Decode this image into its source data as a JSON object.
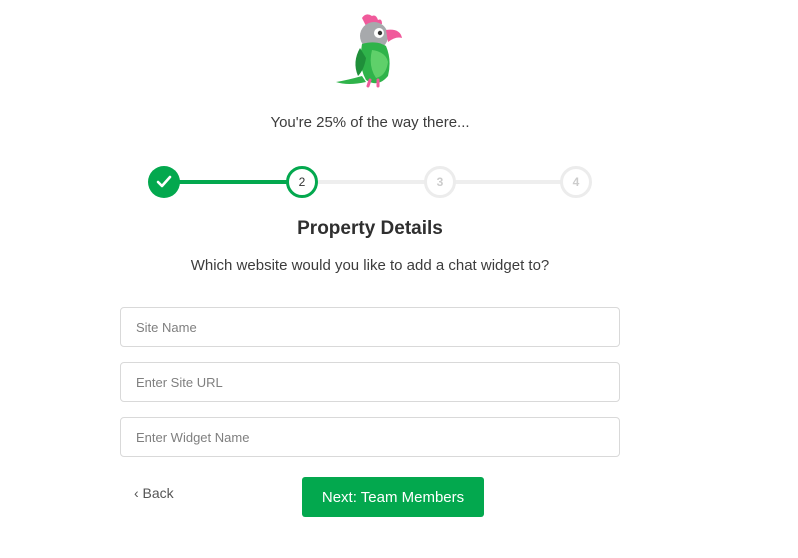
{
  "progress": {
    "text": "You're 25% of the way there...",
    "percent": 25
  },
  "stepper": {
    "steps": [
      {
        "label": "",
        "state": "completed",
        "icon": "check-icon"
      },
      {
        "label": "2",
        "state": "current"
      },
      {
        "label": "3",
        "state": "upcoming"
      },
      {
        "label": "4",
        "state": "upcoming"
      }
    ]
  },
  "header": {
    "title": "Property Details",
    "subtitle": "Which website would you like to add a chat widget to?"
  },
  "form": {
    "site_name": {
      "value": "",
      "placeholder": "Site Name"
    },
    "site_url": {
      "value": "",
      "placeholder": "Enter Site URL"
    },
    "widget_name": {
      "value": "",
      "placeholder": "Enter Widget Name"
    }
  },
  "actions": {
    "back_label": "‹ Back",
    "next_label": "Next: Team Members"
  },
  "colors": {
    "accent": "#03a84e",
    "inactive": "#eeeeee"
  },
  "logo": {
    "icon": "parrot-logo-icon"
  }
}
